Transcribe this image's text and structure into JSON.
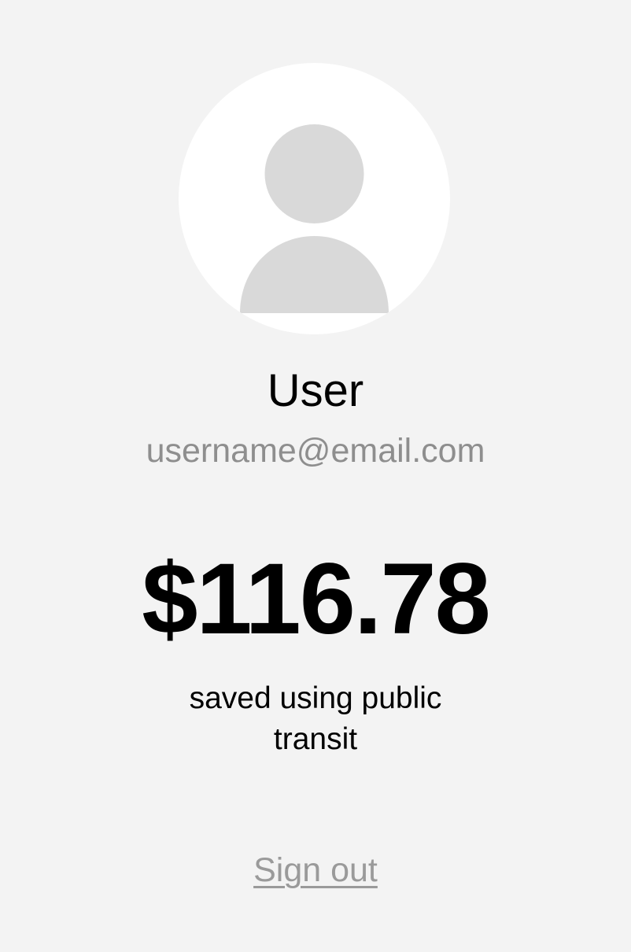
{
  "profile": {
    "avatar_icon": "person-icon",
    "name": "User",
    "email": "username@email.com"
  },
  "savings": {
    "amount": "$116.78",
    "caption": "saved using public transit"
  },
  "actions": {
    "sign_out_label": "Sign out"
  },
  "colors": {
    "background": "#f3f3f3",
    "avatar_bg": "#ffffff",
    "avatar_silhouette": "#d9d9d9",
    "email_text": "#8e8e8e",
    "link_text": "#9a9a9a"
  }
}
